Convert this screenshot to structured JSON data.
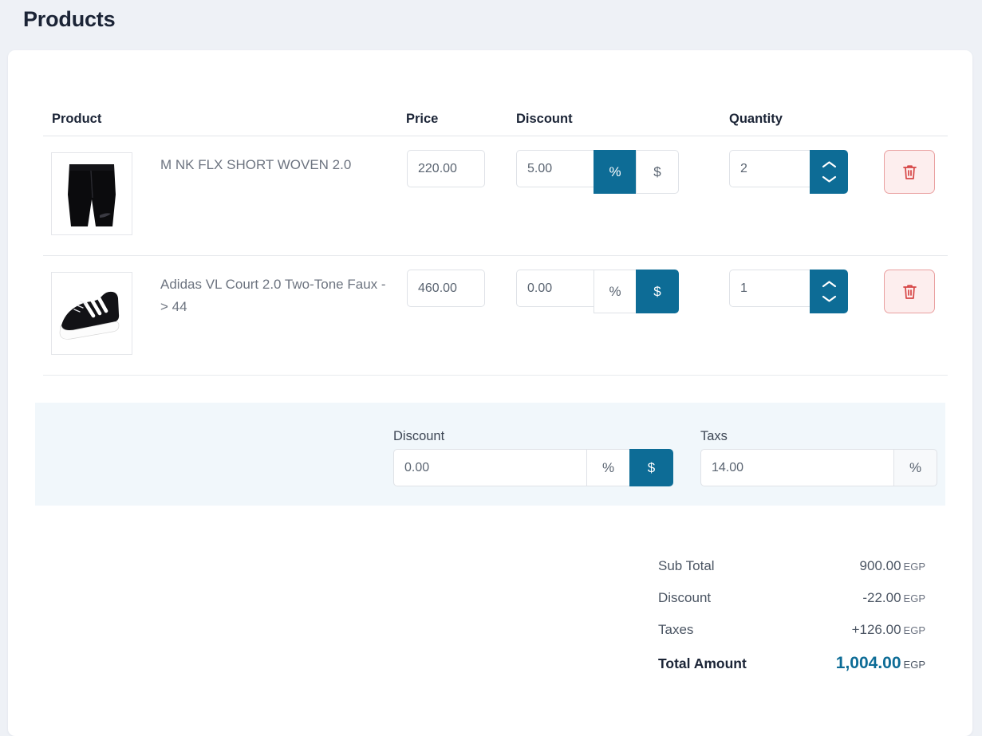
{
  "page": {
    "title": "Products",
    "currency": "EGP",
    "accent_color": "#0d6c96",
    "danger_color": "#d64545",
    "page_background": "#eef1f6",
    "summary_background": "#f1f7fb"
  },
  "table": {
    "headers": {
      "product": "Product",
      "price": "Price",
      "discount": "Discount",
      "quantity": "Quantity"
    },
    "rows": [
      {
        "image_icon": "shorts-image",
        "name": "M NK FLX SHORT WOVEN 2.0",
        "price": "220.00",
        "discount": "5.00",
        "discount_percent_label": "%",
        "discount_amount_label": "$",
        "discount_mode": "percent",
        "quantity": "2",
        "increment_icon": "chevron-up-icon",
        "decrement_icon": "chevron-down-icon",
        "delete_icon": "trash-icon"
      },
      {
        "image_icon": "sneaker-image",
        "name": "Adidas VL Court 2.0 Two-Tone Faux -> 44",
        "price": "460.00",
        "discount": "0.00",
        "discount_percent_label": "%",
        "discount_amount_label": "$",
        "discount_mode": "amount",
        "quantity": "1",
        "increment_icon": "chevron-up-icon",
        "decrement_icon": "chevron-down-icon",
        "delete_icon": "trash-icon"
      }
    ]
  },
  "summary": {
    "discount": {
      "label": "Discount",
      "value": "0.00",
      "percent_label": "%",
      "amount_label": "$",
      "mode": "amount"
    },
    "taxes": {
      "label": "Taxs",
      "value": "14.00",
      "unit_label": "%"
    }
  },
  "totals": {
    "rows": [
      {
        "label": "Sub Total",
        "value": "900.00",
        "currency": "EGP"
      },
      {
        "label": "Discount",
        "value": "-22.00",
        "currency": "EGP"
      },
      {
        "label": "Taxes",
        "value": "+126.00",
        "currency": "EGP"
      }
    ],
    "grand": {
      "label": "Total Amount",
      "value": "1,004.00",
      "currency": "EGP"
    }
  }
}
